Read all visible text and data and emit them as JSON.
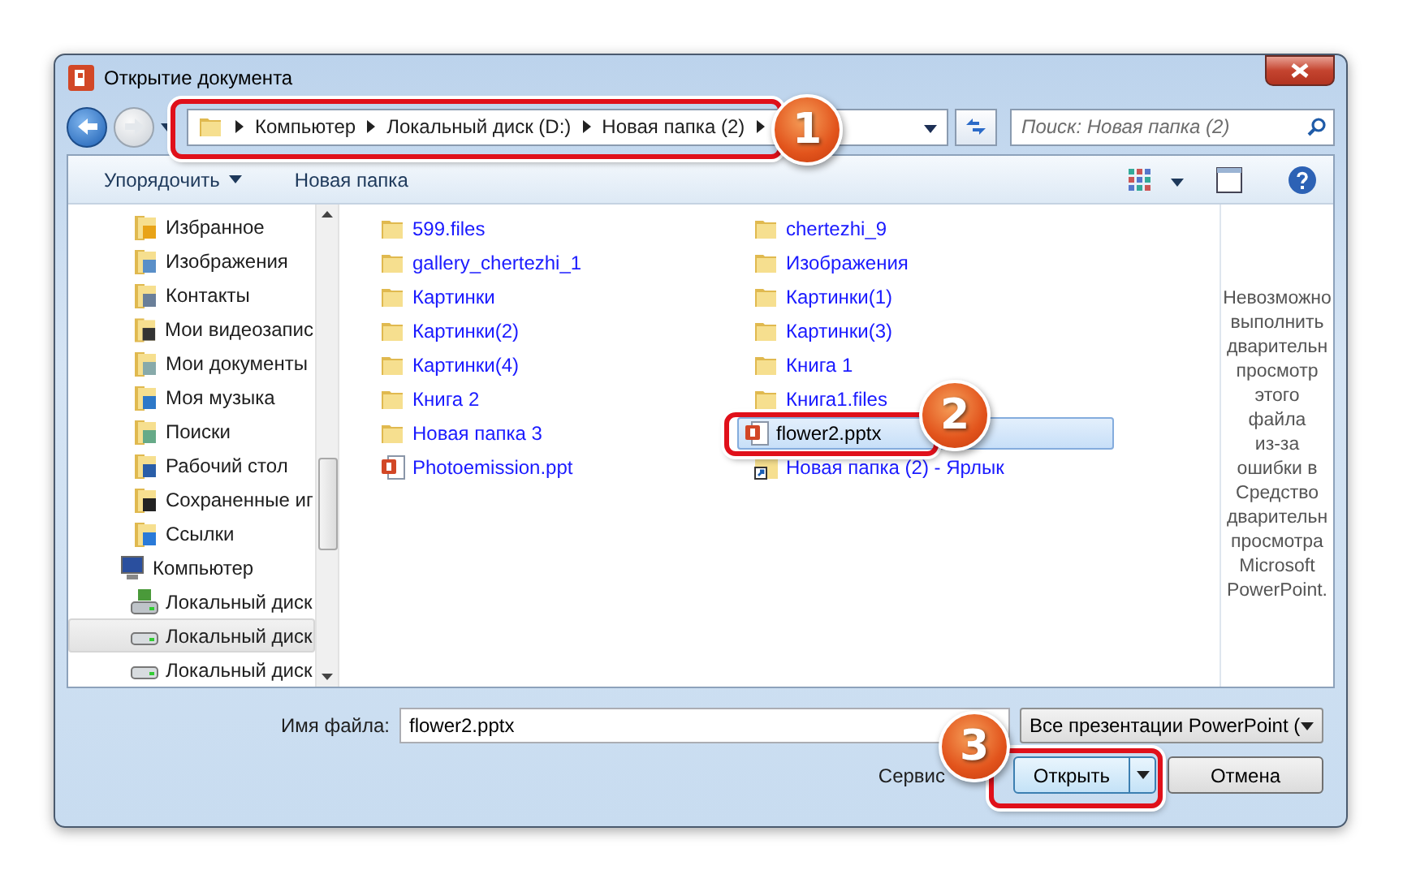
{
  "window": {
    "title": "Открытие документа"
  },
  "address_bar": {
    "segments": [
      "Компьютер",
      "Локальный диск (D:)",
      "Новая папка (2)"
    ]
  },
  "search": {
    "placeholder": "Поиск: Новая папка (2)"
  },
  "toolbar": {
    "organize": "Упорядочить",
    "new_folder": "Новая папка"
  },
  "sidebar": {
    "items": [
      {
        "label": "Избранное",
        "kind": "star",
        "selected": false
      },
      {
        "label": "Изображения",
        "kind": "pictures",
        "selected": false
      },
      {
        "label": "Контакты",
        "kind": "contacts",
        "selected": false
      },
      {
        "label": "Мои видеозапис",
        "kind": "video",
        "selected": false
      },
      {
        "label": "Мои документы",
        "kind": "docs",
        "selected": false
      },
      {
        "label": "Моя музыка",
        "kind": "music",
        "selected": false
      },
      {
        "label": "Поиски",
        "kind": "search",
        "selected": false
      },
      {
        "label": "Рабочий стол",
        "kind": "desktop",
        "selected": false
      },
      {
        "label": "Сохраненные иг",
        "kind": "games",
        "selected": false
      },
      {
        "label": "Ссылки",
        "kind": "links",
        "selected": false
      },
      {
        "label": "Компьютер",
        "kind": "computer",
        "selected": false,
        "children": [
          {
            "label": "Локальный диск",
            "kind": "sysdrive",
            "selected": false
          },
          {
            "label": "Локальный диск",
            "kind": "drive",
            "selected": true
          },
          {
            "label": "Локальный диск",
            "kind": "drive",
            "selected": false
          }
        ]
      }
    ]
  },
  "files": [
    {
      "name": "599.files",
      "kind": "folder",
      "selected": false
    },
    {
      "name": "gallery_chertezhi_1",
      "kind": "folder",
      "selected": false
    },
    {
      "name": "Картинки",
      "kind": "folder",
      "selected": false
    },
    {
      "name": "Картинки(2)",
      "kind": "folder",
      "selected": false
    },
    {
      "name": "Картинки(4)",
      "kind": "folder",
      "selected": false
    },
    {
      "name": "Книга 2",
      "kind": "folder",
      "selected": false
    },
    {
      "name": "Новая папка 3",
      "kind": "folder",
      "selected": false
    },
    {
      "name": "Photoemission.ppt",
      "kind": "ppt",
      "selected": false
    },
    {
      "name": "chertezhi_9",
      "kind": "folder",
      "selected": false
    },
    {
      "name": "Изображения",
      "kind": "folder",
      "selected": false
    },
    {
      "name": "Картинки(1)",
      "kind": "folder",
      "selected": false
    },
    {
      "name": "Картинки(3)",
      "kind": "folder",
      "selected": false
    },
    {
      "name": "Книга 1",
      "kind": "folder",
      "selected": false
    },
    {
      "name": "Книга1.files",
      "kind": "folder",
      "selected": false
    },
    {
      "name": "flower2.pptx",
      "kind": "pptx",
      "selected": true
    },
    {
      "name": "Новая папка (2) - Ярлык",
      "kind": "shortcut",
      "selected": false
    }
  ],
  "preview_lines": [
    "Невозможно",
    "выполнить",
    "дварительн",
    "просмотр",
    "этого",
    "файла",
    "из-за",
    "ошибки в",
    "Средство",
    "дварительн",
    "просмотра",
    "Microsoft",
    "PowerPoint."
  ],
  "bottom": {
    "filename_label": "Имя файла:",
    "filename_value": "flower2.pptx",
    "filetype": "Все презентации PowerPoint (",
    "tools": "Сервис",
    "open": "Открыть",
    "cancel": "Отмена"
  },
  "callouts": [
    "1",
    "2",
    "3"
  ]
}
